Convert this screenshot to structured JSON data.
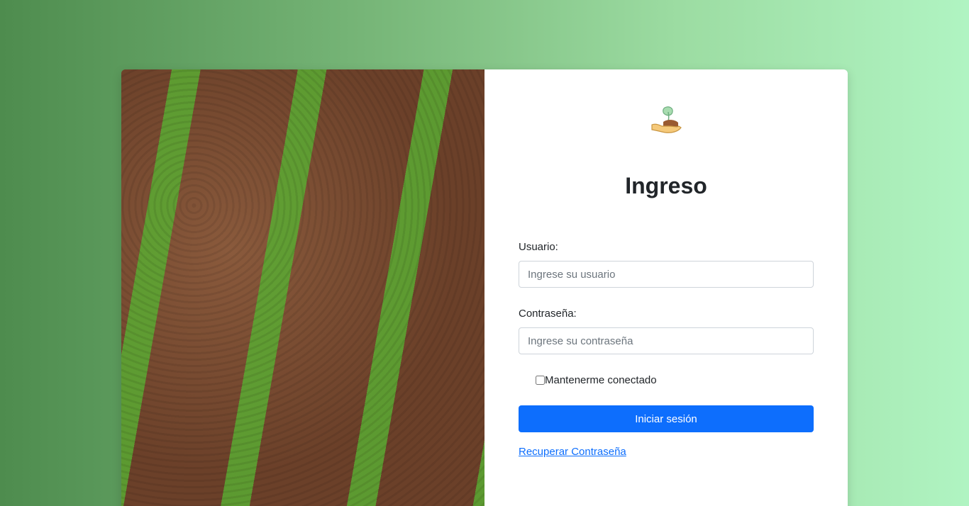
{
  "title": "Ingreso",
  "username": {
    "label": "Usuario:",
    "placeholder": "Ingrese su usuario",
    "value": ""
  },
  "password": {
    "label": "Contraseña:",
    "placeholder": "Ingrese su contraseña",
    "value": ""
  },
  "remember_label": "Mantenerme conectado",
  "submit_label": "Iniciar sesión",
  "recover_link": "Recuperar Contraseña",
  "colors": {
    "primary": "#0d6efd",
    "bg_start": "#4e8c4e",
    "bg_end": "#b0f4c2"
  }
}
